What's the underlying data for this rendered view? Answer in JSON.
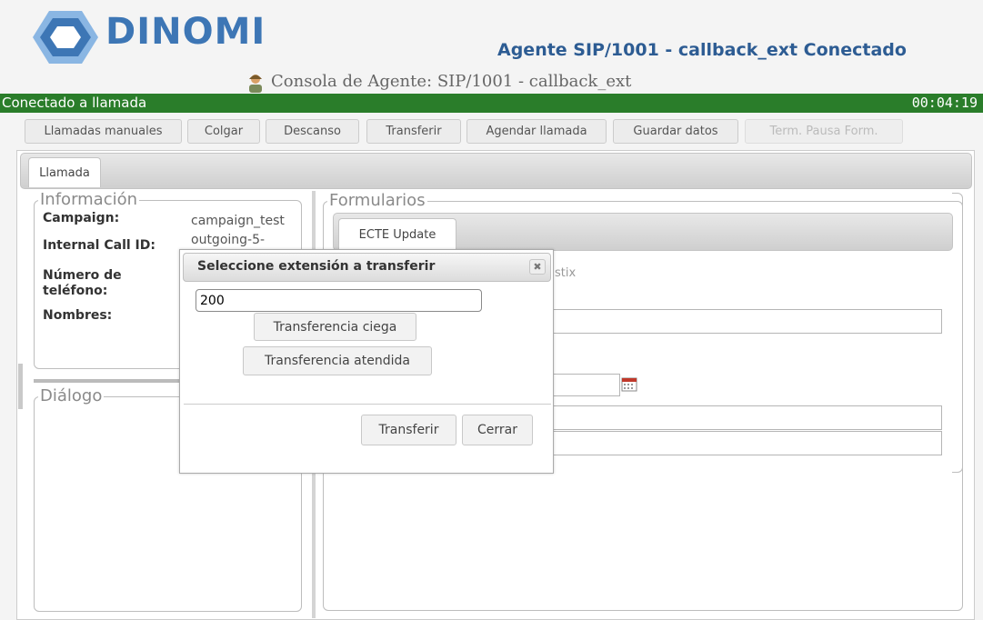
{
  "header": {
    "logo_text": "DINOMI",
    "agent_status_title": "Agente SIP/1001 - callback_ext Conectado",
    "console_title": "Consola de Agente: SIP/1001 - callback_ext"
  },
  "status_bar": {
    "text": "Conectado a llamada",
    "timer": "00:04:19"
  },
  "toolbar": {
    "buttons": [
      "Llamadas manuales",
      "Colgar",
      "Descanso",
      "Transferir",
      "Agendar llamada",
      "Guardar datos",
      "Term. Pausa Form."
    ]
  },
  "tabs": {
    "call": "Llamada"
  },
  "info": {
    "legend": "Información",
    "campaign_label": "Campaign:",
    "campaign_value": "campaign_test",
    "call_id_label": "Internal Call ID:",
    "call_id_value": "outgoing-5-",
    "phone_label_1": "Número de",
    "phone_label_2": "teléfono:",
    "names_label": "Nombres:"
  },
  "dialog_panel": {
    "legend": "Diálogo"
  },
  "forms": {
    "legend": "Formularios",
    "tab": "ECTE Update",
    "partial_text": "stix"
  },
  "transfer_dialog": {
    "title": "Seleccione extensión a transferir",
    "close_glyph": "✖",
    "extension_value": "200",
    "blind_label": "Transferencia ciega",
    "attended_label": "Transferencia atendida",
    "transfer_label": "Transferir",
    "close_label": "Cerrar"
  },
  "colors": {
    "status_green": "#2a7d2a",
    "brand_blue": "#3d76b5",
    "title_blue": "#2d5c93"
  }
}
